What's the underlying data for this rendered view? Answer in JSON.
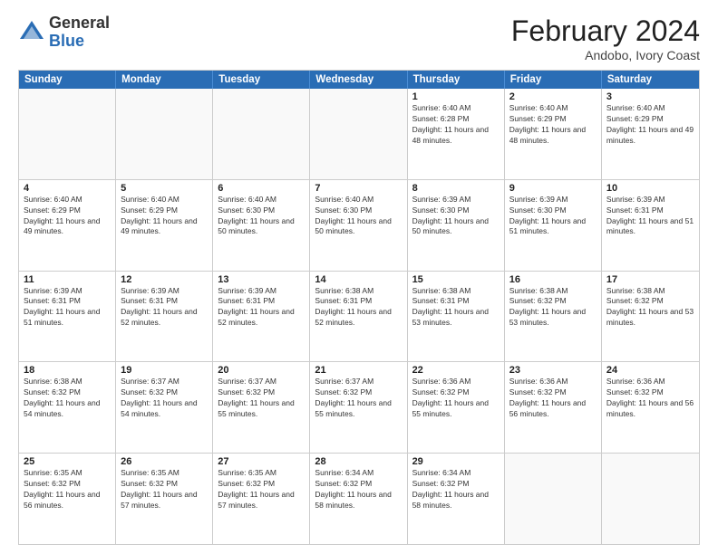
{
  "logo": {
    "general": "General",
    "blue": "Blue"
  },
  "title": {
    "month": "February 2024",
    "location": "Andobo, Ivory Coast"
  },
  "days_of_week": [
    "Sunday",
    "Monday",
    "Tuesday",
    "Wednesday",
    "Thursday",
    "Friday",
    "Saturday"
  ],
  "weeks": [
    [
      {
        "day": "",
        "sunrise": "",
        "sunset": "",
        "daylight": ""
      },
      {
        "day": "",
        "sunrise": "",
        "sunset": "",
        "daylight": ""
      },
      {
        "day": "",
        "sunrise": "",
        "sunset": "",
        "daylight": ""
      },
      {
        "day": "",
        "sunrise": "",
        "sunset": "",
        "daylight": ""
      },
      {
        "day": "1",
        "sunrise": "Sunrise: 6:40 AM",
        "sunset": "Sunset: 6:28 PM",
        "daylight": "Daylight: 11 hours and 48 minutes."
      },
      {
        "day": "2",
        "sunrise": "Sunrise: 6:40 AM",
        "sunset": "Sunset: 6:29 PM",
        "daylight": "Daylight: 11 hours and 48 minutes."
      },
      {
        "day": "3",
        "sunrise": "Sunrise: 6:40 AM",
        "sunset": "Sunset: 6:29 PM",
        "daylight": "Daylight: 11 hours and 49 minutes."
      }
    ],
    [
      {
        "day": "4",
        "sunrise": "Sunrise: 6:40 AM",
        "sunset": "Sunset: 6:29 PM",
        "daylight": "Daylight: 11 hours and 49 minutes."
      },
      {
        "day": "5",
        "sunrise": "Sunrise: 6:40 AM",
        "sunset": "Sunset: 6:29 PM",
        "daylight": "Daylight: 11 hours and 49 minutes."
      },
      {
        "day": "6",
        "sunrise": "Sunrise: 6:40 AM",
        "sunset": "Sunset: 6:30 PM",
        "daylight": "Daylight: 11 hours and 50 minutes."
      },
      {
        "day": "7",
        "sunrise": "Sunrise: 6:40 AM",
        "sunset": "Sunset: 6:30 PM",
        "daylight": "Daylight: 11 hours and 50 minutes."
      },
      {
        "day": "8",
        "sunrise": "Sunrise: 6:39 AM",
        "sunset": "Sunset: 6:30 PM",
        "daylight": "Daylight: 11 hours and 50 minutes."
      },
      {
        "day": "9",
        "sunrise": "Sunrise: 6:39 AM",
        "sunset": "Sunset: 6:30 PM",
        "daylight": "Daylight: 11 hours and 51 minutes."
      },
      {
        "day": "10",
        "sunrise": "Sunrise: 6:39 AM",
        "sunset": "Sunset: 6:31 PM",
        "daylight": "Daylight: 11 hours and 51 minutes."
      }
    ],
    [
      {
        "day": "11",
        "sunrise": "Sunrise: 6:39 AM",
        "sunset": "Sunset: 6:31 PM",
        "daylight": "Daylight: 11 hours and 51 minutes."
      },
      {
        "day": "12",
        "sunrise": "Sunrise: 6:39 AM",
        "sunset": "Sunset: 6:31 PM",
        "daylight": "Daylight: 11 hours and 52 minutes."
      },
      {
        "day": "13",
        "sunrise": "Sunrise: 6:39 AM",
        "sunset": "Sunset: 6:31 PM",
        "daylight": "Daylight: 11 hours and 52 minutes."
      },
      {
        "day": "14",
        "sunrise": "Sunrise: 6:38 AM",
        "sunset": "Sunset: 6:31 PM",
        "daylight": "Daylight: 11 hours and 52 minutes."
      },
      {
        "day": "15",
        "sunrise": "Sunrise: 6:38 AM",
        "sunset": "Sunset: 6:31 PM",
        "daylight": "Daylight: 11 hours and 53 minutes."
      },
      {
        "day": "16",
        "sunrise": "Sunrise: 6:38 AM",
        "sunset": "Sunset: 6:32 PM",
        "daylight": "Daylight: 11 hours and 53 minutes."
      },
      {
        "day": "17",
        "sunrise": "Sunrise: 6:38 AM",
        "sunset": "Sunset: 6:32 PM",
        "daylight": "Daylight: 11 hours and 53 minutes."
      }
    ],
    [
      {
        "day": "18",
        "sunrise": "Sunrise: 6:38 AM",
        "sunset": "Sunset: 6:32 PM",
        "daylight": "Daylight: 11 hours and 54 minutes."
      },
      {
        "day": "19",
        "sunrise": "Sunrise: 6:37 AM",
        "sunset": "Sunset: 6:32 PM",
        "daylight": "Daylight: 11 hours and 54 minutes."
      },
      {
        "day": "20",
        "sunrise": "Sunrise: 6:37 AM",
        "sunset": "Sunset: 6:32 PM",
        "daylight": "Daylight: 11 hours and 55 minutes."
      },
      {
        "day": "21",
        "sunrise": "Sunrise: 6:37 AM",
        "sunset": "Sunset: 6:32 PM",
        "daylight": "Daylight: 11 hours and 55 minutes."
      },
      {
        "day": "22",
        "sunrise": "Sunrise: 6:36 AM",
        "sunset": "Sunset: 6:32 PM",
        "daylight": "Daylight: 11 hours and 55 minutes."
      },
      {
        "day": "23",
        "sunrise": "Sunrise: 6:36 AM",
        "sunset": "Sunset: 6:32 PM",
        "daylight": "Daylight: 11 hours and 56 minutes."
      },
      {
        "day": "24",
        "sunrise": "Sunrise: 6:36 AM",
        "sunset": "Sunset: 6:32 PM",
        "daylight": "Daylight: 11 hours and 56 minutes."
      }
    ],
    [
      {
        "day": "25",
        "sunrise": "Sunrise: 6:35 AM",
        "sunset": "Sunset: 6:32 PM",
        "daylight": "Daylight: 11 hours and 56 minutes."
      },
      {
        "day": "26",
        "sunrise": "Sunrise: 6:35 AM",
        "sunset": "Sunset: 6:32 PM",
        "daylight": "Daylight: 11 hours and 57 minutes."
      },
      {
        "day": "27",
        "sunrise": "Sunrise: 6:35 AM",
        "sunset": "Sunset: 6:32 PM",
        "daylight": "Daylight: 11 hours and 57 minutes."
      },
      {
        "day": "28",
        "sunrise": "Sunrise: 6:34 AM",
        "sunset": "Sunset: 6:32 PM",
        "daylight": "Daylight: 11 hours and 58 minutes."
      },
      {
        "day": "29",
        "sunrise": "Sunrise: 6:34 AM",
        "sunset": "Sunset: 6:32 PM",
        "daylight": "Daylight: 11 hours and 58 minutes."
      },
      {
        "day": "",
        "sunrise": "",
        "sunset": "",
        "daylight": ""
      },
      {
        "day": "",
        "sunrise": "",
        "sunset": "",
        "daylight": ""
      }
    ]
  ]
}
